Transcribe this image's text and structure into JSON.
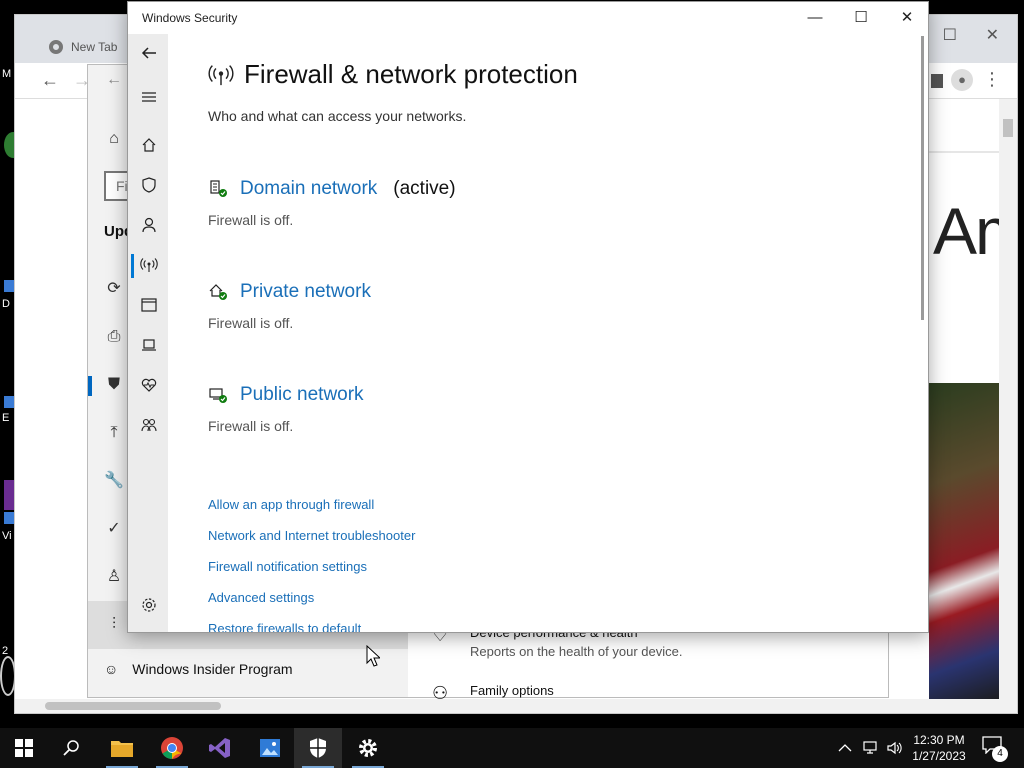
{
  "desktop": {
    "labels": [
      "M",
      "D",
      "E",
      "Vi",
      "2"
    ]
  },
  "chrome": {
    "tab_title": "New Tab",
    "hero_text": "Am",
    "icons": [
      "chrome-logo-icon",
      "back-icon",
      "forward-icon",
      "profile-icon",
      "menu-kebab-icon"
    ]
  },
  "settings": {
    "search_placeholder": "Fi",
    "section_heading": "Upd",
    "insider_label": "Windows Insider Program",
    "rows": [
      {
        "title": "Device performance & health",
        "desc": "Reports on the health of your device."
      },
      {
        "title": "Family options",
        "desc": ""
      }
    ]
  },
  "security": {
    "window_title": "Windows Security",
    "page_title": "Firewall & network protection",
    "page_subtitle": "Who and what can access your networks.",
    "networks": [
      {
        "name": "Domain network",
        "active_label": "(active)",
        "status": "Firewall is off."
      },
      {
        "name": "Private network",
        "active_label": "",
        "status": "Firewall is off."
      },
      {
        "name": "Public network",
        "active_label": "",
        "status": "Firewall is off."
      }
    ],
    "links": [
      "Allow an app through firewall",
      "Network and Internet troubleshooter",
      "Firewall notification settings",
      "Advanced settings",
      "Restore firewalls to default"
    ],
    "accent_color": "#1a6fb8",
    "status_ok_color": "#107c10"
  },
  "taskbar": {
    "apps": [
      "start-button",
      "search-button",
      "file-explorer",
      "chrome",
      "visual-studio",
      "photos",
      "windows-security",
      "settings"
    ],
    "time": "12:30 PM",
    "date": "1/27/2023",
    "notification_count": "4"
  }
}
